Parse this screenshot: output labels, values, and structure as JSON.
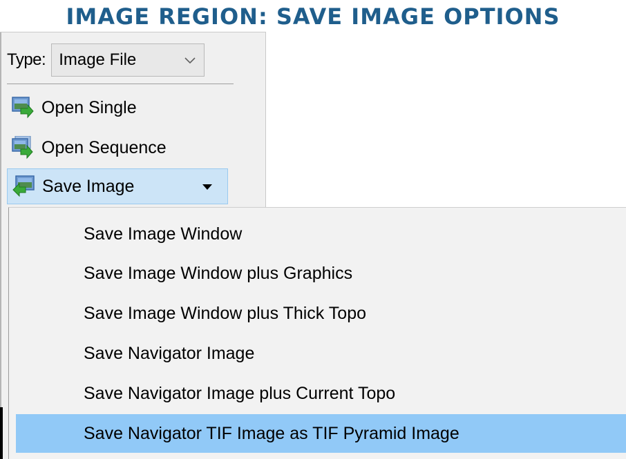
{
  "page_title": "IMAGE REGION: SAVE IMAGE OPTIONS",
  "type_row": {
    "label": "Type:",
    "selected": "Image File"
  },
  "commands": {
    "open_single": "Open Single",
    "open_sequence": "Open Sequence",
    "save_image": "Save Image"
  },
  "menu": {
    "items": [
      "Save Image Window",
      "Save Image Window plus Graphics",
      "Save Image Window plus Thick Topo",
      "Save Navigator Image",
      "Save Navigator Image plus Current Topo",
      "Save Navigator TIF Image as TIF Pyramid Image"
    ],
    "highlighted_index": 5
  },
  "colors": {
    "title": "#1f5e8c",
    "hover_button": "#cce4f7",
    "menu_highlight": "#91c9f7"
  }
}
